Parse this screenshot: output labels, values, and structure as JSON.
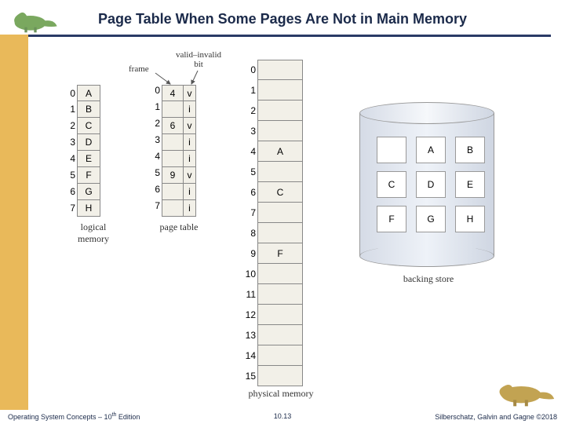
{
  "title": "Page Table When Some Pages Are Not in Main Memory",
  "footer": {
    "left_pre": "Operating System Concepts – 10",
    "left_sup": "th",
    "left_post": " Edition",
    "center": "10.13",
    "right": "Silberschatz, Galvin and Gagne ©2018"
  },
  "labels": {
    "logical": "logical\nmemory",
    "page_table": "page table",
    "frame": "frame",
    "valid_invalid": "valid–invalid\nbit",
    "physical": "physical memory",
    "backing_store": "backing store"
  },
  "logical_memory": {
    "indices": [
      0,
      1,
      2,
      3,
      4,
      5,
      6,
      7
    ],
    "pages": [
      "A",
      "B",
      "C",
      "D",
      "E",
      "F",
      "G",
      "H"
    ]
  },
  "page_table": {
    "indices": [
      0,
      1,
      2,
      3,
      4,
      5,
      6,
      7
    ],
    "rows": [
      {
        "frame": "4",
        "bit": "v"
      },
      {
        "frame": "",
        "bit": "i"
      },
      {
        "frame": "6",
        "bit": "v"
      },
      {
        "frame": "",
        "bit": "i"
      },
      {
        "frame": "",
        "bit": "i"
      },
      {
        "frame": "9",
        "bit": "v"
      },
      {
        "frame": "",
        "bit": "i"
      },
      {
        "frame": "",
        "bit": "i"
      }
    ]
  },
  "physical_memory": {
    "indices": [
      0,
      1,
      2,
      3,
      4,
      5,
      6,
      7,
      8,
      9,
      10,
      11,
      12,
      13,
      14,
      15
    ],
    "frames": [
      "",
      "",
      "",
      "",
      "A",
      "",
      "C",
      "",
      "",
      "F",
      "",
      "",
      "",
      "",
      "",
      ""
    ]
  },
  "backing_store": {
    "slots": [
      "",
      "A",
      "B",
      "C",
      "D",
      "E",
      "F",
      "G",
      "H"
    ]
  }
}
